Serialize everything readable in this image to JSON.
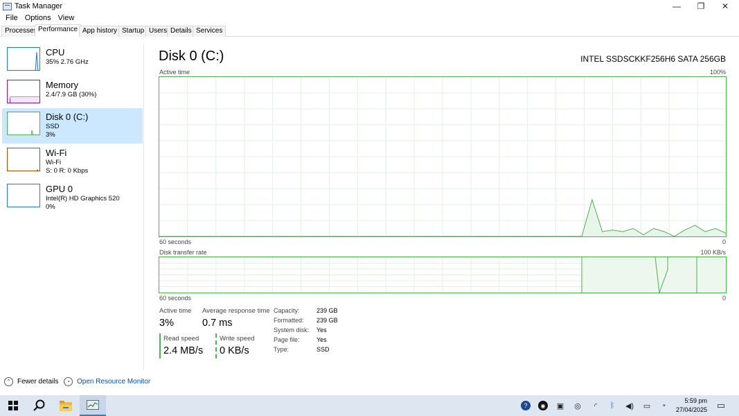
{
  "window": {
    "title": "Task Manager",
    "controls": {
      "minimize": "—",
      "restore": "❐",
      "close": "✕"
    }
  },
  "menu": [
    "File",
    "Options",
    "View"
  ],
  "tabs": [
    "Processes",
    "Performance",
    "App history",
    "Startup",
    "Users",
    "Details",
    "Services"
  ],
  "active_tab": "Performance",
  "sidebar": {
    "items": [
      {
        "name": "CPU",
        "lines": [
          "35% 2.76 GHz"
        ],
        "color": "#1c7ebb"
      },
      {
        "name": "Memory",
        "lines": [
          "2.4/7.9 GB (30%)"
        ],
        "color": "#8b12ae"
      },
      {
        "name": "Disk 0 (C:)",
        "lines": [
          "SSD",
          "3%"
        ],
        "color": "#4caf50",
        "selected": true
      },
      {
        "name": "Wi-Fi",
        "lines": [
          "Wi-Fi",
          "S: 0 R: 0 Kbps"
        ],
        "color": "#a74f01"
      },
      {
        "name": "GPU 0",
        "lines": [
          "Intel(R) HD Graphics 520",
          "0%"
        ],
        "color": "#1c7ebb"
      }
    ]
  },
  "main": {
    "title": "Disk 0 (C:)",
    "model": "INTEL SSDSCKKF256H6 SATA 256GB",
    "active_graph": {
      "label": "Active time",
      "max_label": "100%",
      "time_label": "60 seconds",
      "min_label": "0",
      "values_percent": [
        0,
        23,
        3,
        4,
        3,
        5,
        1,
        5,
        3,
        0,
        4,
        7,
        3,
        5,
        2
      ]
    },
    "transfer_graph": {
      "label": "Disk transfer rate",
      "max_label": "100 KB/s",
      "time_label": "60 seconds",
      "min_label": "0"
    },
    "stats": {
      "active_time_label": "Active time",
      "active_time_value": "3%",
      "response_label": "Average response time",
      "response_value": "0.7 ms",
      "read_label": "Read speed",
      "read_value": "2.4 MB/s",
      "write_label": "Write speed",
      "write_value": "0 KB/s"
    },
    "properties": [
      {
        "key": "Capacity:",
        "value": "239 GB"
      },
      {
        "key": "Formatted:",
        "value": "239 GB"
      },
      {
        "key": "System disk:",
        "value": "Yes"
      },
      {
        "key": "Page file:",
        "value": "Yes"
      },
      {
        "key": "Type:",
        "value": "SSD"
      }
    ]
  },
  "footer": {
    "fewer_details": "Fewer details",
    "resource_monitor": "Open Resource Monitor"
  },
  "taskbar": {
    "time": "5:59 pm",
    "date": "27/04/2025"
  }
}
